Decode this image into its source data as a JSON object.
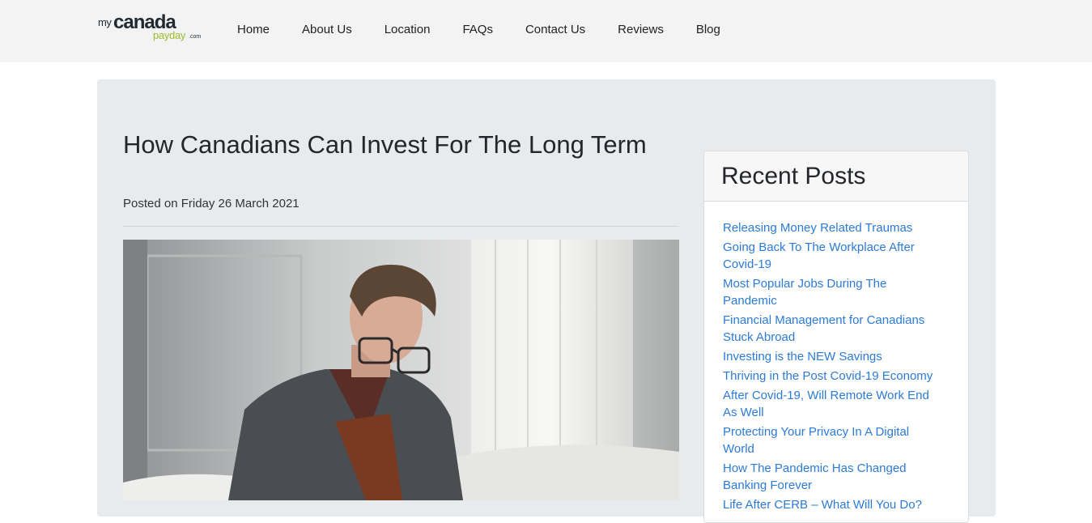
{
  "logo": {
    "part1": "my",
    "part2": "canada",
    "part3": "payday",
    "part4": ".com"
  },
  "nav": {
    "items": [
      "Home",
      "About Us",
      "Location",
      "FAQs",
      "Contact Us",
      "Reviews",
      "Blog"
    ]
  },
  "article": {
    "title": "How Canadians Can Invest For The Long Term",
    "posted": "Posted on Friday 26 March 2021"
  },
  "sidebar": {
    "heading": "Recent Posts",
    "posts": [
      "Releasing Money Related Traumas",
      "Going Back To The Workplace After Covid-19",
      "Most Popular Jobs During The Pandemic",
      "Financial Management for Canadians Stuck Abroad",
      "Investing is the NEW Savings",
      "Thriving in the Post Covid-19 Economy",
      "After Covid-19, Will Remote Work End As Well",
      "Protecting Your Privacy In A Digital World",
      "How The Pandemic Has Changed Banking Forever",
      "Life After CERB – What Will You Do?"
    ]
  }
}
